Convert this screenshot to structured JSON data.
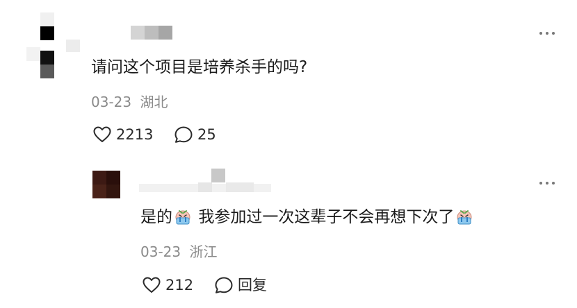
{
  "comment": {
    "text": "请问这个项目是培养杀手的吗?",
    "date": "03-23",
    "location": "湖北",
    "likes": "2213",
    "replies": "25",
    "more_icon": "more-horizontal-icon"
  },
  "reply": {
    "text_part1": "是的",
    "text_part2": "我参加过一次这辈子不会再想下次了",
    "emoji": "crying-face-emoji",
    "date": "03-23",
    "location": "浙江",
    "likes": "212",
    "reply_label": "回复",
    "more_icon": "more-horizontal-icon"
  }
}
